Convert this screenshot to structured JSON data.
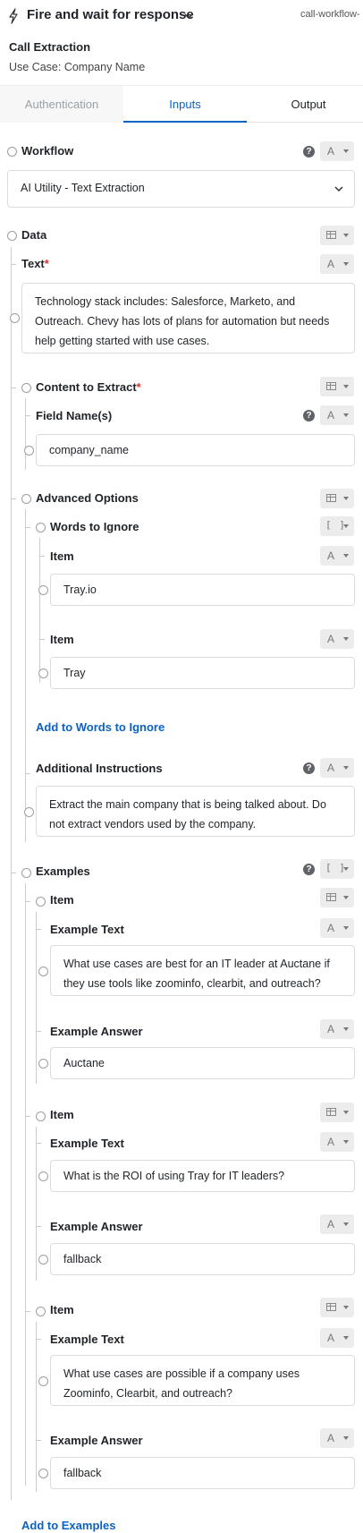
{
  "header": {
    "title": "Fire and wait for response",
    "workflow_name": "call-workflow-",
    "bolt_icon": "bolt-icon",
    "chevron_icon": "chevron-down-icon"
  },
  "step": {
    "name": "Call Extraction",
    "use_case": "Use Case: Company Name"
  },
  "tabs": [
    {
      "label": "Authentication",
      "state": "disabled"
    },
    {
      "label": "Inputs",
      "state": "active"
    },
    {
      "label": "Output",
      "state": "normal"
    }
  ],
  "workflow": {
    "label": "Workflow",
    "type_glyph": "A",
    "value": "AI Utility - Text Extraction"
  },
  "data": {
    "label": "Data",
    "text": {
      "label": "Text",
      "required_mark": "*",
      "type_glyph": "A",
      "value": "Technology stack includes: Salesforce, Marketo, and Outreach. Chevy has lots of plans for automation but needs help getting started with use cases."
    },
    "content_to_extract": {
      "label": "Content to Extract",
      "required_mark": "*",
      "field_names": {
        "label": "Field Name(s)",
        "type_glyph": "A",
        "value": "company_name"
      }
    },
    "advanced_options": {
      "label": "Advanced Options",
      "words_to_ignore": {
        "label": "Words to Ignore",
        "type_glyph": "[ ]",
        "items": [
          {
            "label": "Item",
            "type_glyph": "A",
            "value": "Tray.io"
          },
          {
            "label": "Item",
            "type_glyph": "A",
            "value": "Tray"
          }
        ],
        "add_label": "Add to Words to Ignore"
      },
      "additional_instructions": {
        "label": "Additional Instructions",
        "type_glyph": "A",
        "value": "Extract the main company that is being talked about. Do not extract vendors used by the company."
      }
    },
    "examples": {
      "label": "Examples",
      "type_glyph": "[ ]",
      "items": [
        {
          "label": "Item",
          "example_text_label": "Example Text",
          "example_text": "What use cases are best for an IT leader at Auctane if they use tools like zoominfo, clearbit, and outreach?",
          "example_answer_label": "Example Answer",
          "example_answer": "Auctane"
        },
        {
          "label": "Item",
          "example_text_label": "Example Text",
          "example_text": "What is the ROI of using Tray for IT leaders?",
          "example_answer_label": "Example Answer",
          "example_answer": "fallback"
        },
        {
          "label": "Item",
          "example_text_label": "Example Text",
          "example_text": "What use cases are possible if a company uses Zoominfo, Clearbit, and outreach?",
          "example_answer_label": "Example Answer",
          "example_answer": "fallback"
        }
      ],
      "add_label": "Add to Examples"
    }
  },
  "help_glyph": "?"
}
